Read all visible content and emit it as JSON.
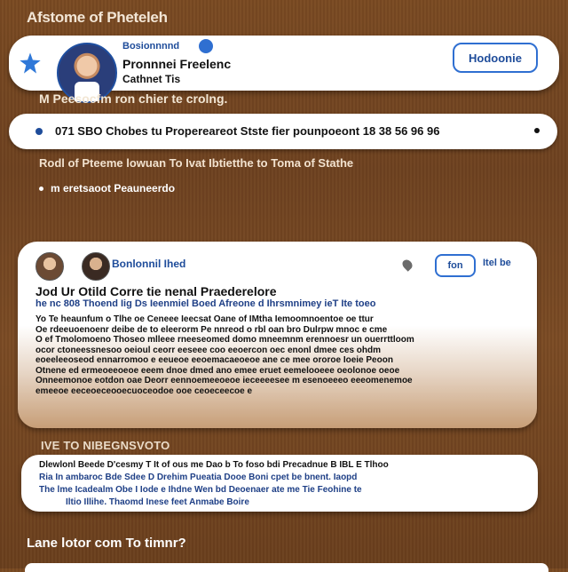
{
  "page": {
    "top_title": "Afstome of Pheteleh",
    "caption": "M Peesocfm ron chier te crolng.",
    "sub_line": "Rodl of Pteeme lowuan To Ivat Ibtietthe to Toma of Stathe",
    "bullet_line": "m eretsaoot Peauneerdo",
    "section_label": "IVE TO NIBEGNSVOTO",
    "bottom_prompt": "Lane lotor com To timnr?"
  },
  "profile": {
    "handle": "Bosionnnnd",
    "name": "Pronnnei Freelenc",
    "subname": "Cathnet Tis",
    "follow_label": "Hodoonie"
  },
  "headline": {
    "text": "071 SBO Chobes tu Propereareot Stste fier pounpoeont 18 38 56 96 96"
  },
  "post": {
    "handle": "Bonlonnil Ihed",
    "join_label": "fon",
    "more_label": "Itel be",
    "title": "Jod Ur Otild Corre tie nenal Praederelore",
    "subtitle": "he nc 808 Thoend Iig Ds Ieenmiel Boed Afreone d Ihrsmnimey ieT Ite toeo",
    "body": [
      "Yo Te heaunfum o Tlhe oe Ceneee Ieecsat Oane of IMtha Iemoomnoentoe oe ttur",
      "Oe rdeeuoenoenr deibe de to eleerorm Pe nnreod o rbl oan bro Dulrpw mnoc e cme",
      "O ef Tmolomoeno Thoseo mlleee rneeseomed domo mneemnm erennoesr un ouerrttloom",
      "ocor ctoneessnesoo oeioul ceorr eeseee coo eeoercon oec enonl dmee ces ohdm",
      "eoeeleeoseod ennarromoo e eeueoe eeoemacaeoeoe ane ce mee ororoe Ioeie Peoon",
      "Otnene ed ermeoeeoeoe eeem dnoe dmed ano emee eruet eemelooeee oeolonoe oeoe",
      "Onneemonoe eotdon oae Deorr eennoemeeoeoe ieceeeesee m esenoeeeo eeeomenemoe",
      "emeeoe eeceoeceooecuoceodoe ooe ceoeceecoe e"
    ]
  },
  "info": {
    "line1": "Dlewlonl Beede D'cesmy T It of ous me Dao b To foso bdi Precadnue B IBL E Tlhoo",
    "line2": "Ria In ambaroc Bde Sdee D Drehim Pueatia Dooe Boni cpet be bnent. Iaopd",
    "line3": "The lme Icadealm Obe I Iode e Ihdne Wen bd Deoenaer ate me Tie Feohine te",
    "line4": "Iltio Illihe. Thaomd Inese feet Anmabe Boire"
  },
  "colors": {
    "background": "#7a4a22",
    "accent_blue": "#2f6fd1",
    "link_blue": "#1e4c9a"
  },
  "icons": {
    "star": "star-icon",
    "verified": "verified-badge-icon",
    "pin": "location-pin-icon"
  }
}
